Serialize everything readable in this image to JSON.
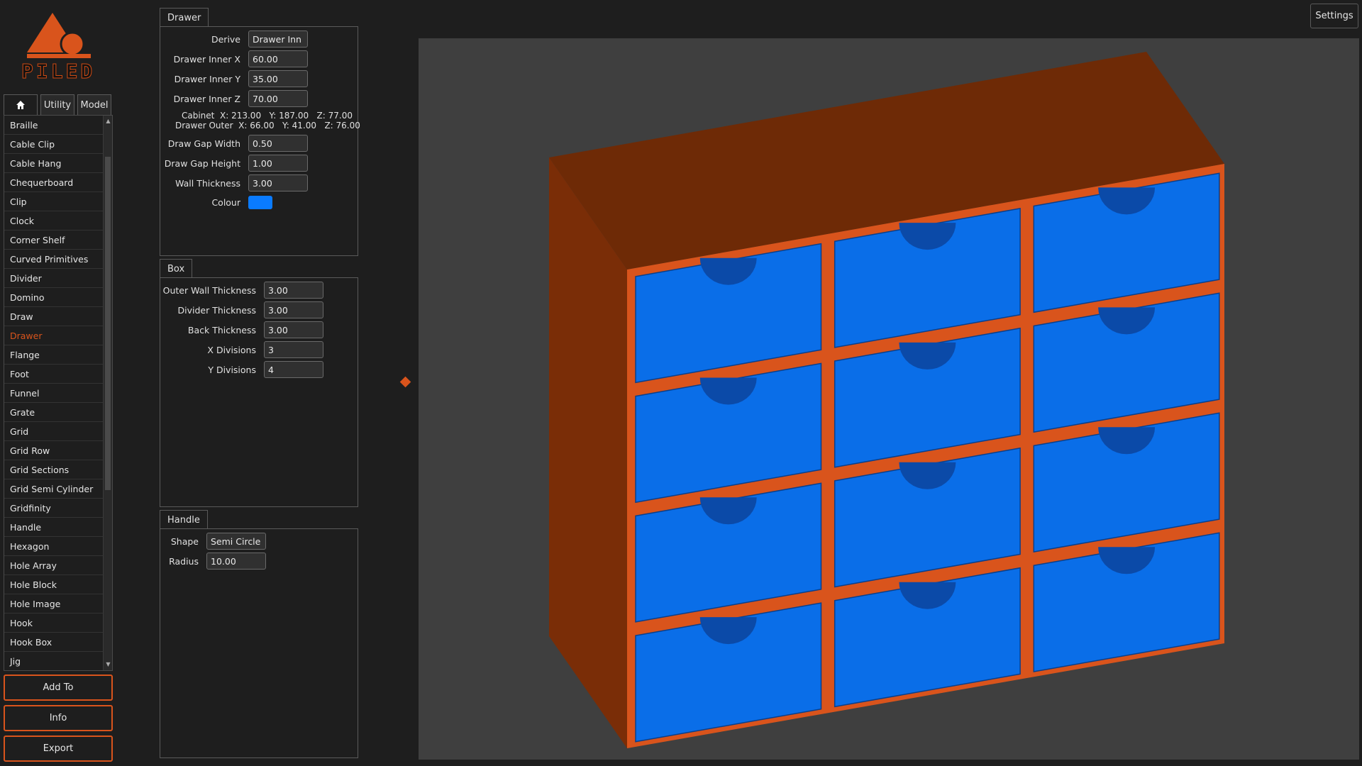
{
  "app": {
    "name": "PILED"
  },
  "colors": {
    "accent": "#d9541c",
    "drawer_blue": "#0a6ee8",
    "cabinet_brown": "#7a2d08"
  },
  "header": {
    "settings_label": "Settings"
  },
  "tabs": [
    {
      "label": "",
      "icon": "home-icon"
    },
    {
      "label": "Utility"
    },
    {
      "label": "Model"
    }
  ],
  "model_list": {
    "selected": "Drawer",
    "items": [
      "Braille",
      "Cable Clip",
      "Cable Hang",
      "Chequerboard",
      "Clip",
      "Clock",
      "Corner Shelf",
      "Curved Primitives",
      "Divider",
      "Domino",
      "Draw",
      "Drawer",
      "Flange",
      "Foot",
      "Funnel",
      "Grate",
      "Grid",
      "Grid Row",
      "Grid Sections",
      "Grid Semi Cylinder",
      "Gridfinity",
      "Handle",
      "Hexagon",
      "Hole Array",
      "Hole Block",
      "Hole Image",
      "Hook",
      "Hook Box",
      "Jig"
    ]
  },
  "actions": {
    "add_to": "Add To",
    "info": "Info",
    "export": "Export"
  },
  "drawer": {
    "title": "Drawer",
    "derive_label": "Derive",
    "derive_value": "Drawer Inn",
    "inner_x_label": "Drawer Inner X",
    "inner_x": "60.00",
    "inner_y_label": "Drawer Inner Y",
    "inner_y": "35.00",
    "inner_z_label": "Drawer Inner Z",
    "inner_z": "70.00",
    "cabinet_line": "Cabinet  X: 213.00   Y: 187.00   Z: 77.00",
    "outer_line": "Drawer Outer  X: 66.00   Y: 41.00   Z: 76.00",
    "gap_width_label": "Draw Gap Width",
    "gap_width": "0.50",
    "gap_height_label": "Draw Gap Height",
    "gap_height": "1.00",
    "wall_label": "Wall Thickness",
    "wall": "3.00",
    "colour_label": "Colour",
    "colour": "#0a7bff"
  },
  "box": {
    "title": "Box",
    "outer_wall_label": "Outer Wall Thickness",
    "outer_wall": "3.00",
    "divider_label": "Divider Thickness",
    "divider": "3.00",
    "back_label": "Back Thickness",
    "back": "3.00",
    "x_div_label": "X Divisions",
    "x_div": "3",
    "y_div_label": "Y Divisions",
    "y_div": "4"
  },
  "handle": {
    "title": "Handle",
    "shape_label": "Shape",
    "shape": "Semi Circle",
    "radius_label": "Radius",
    "radius": "10.00"
  }
}
